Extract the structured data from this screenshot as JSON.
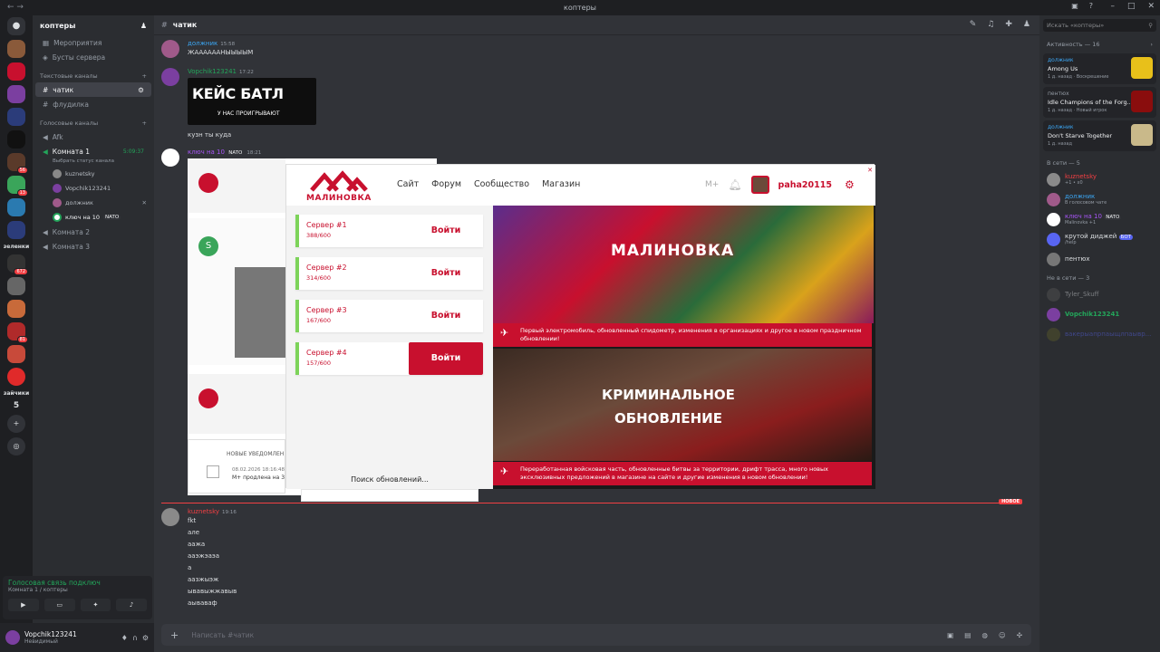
{
  "window": {
    "title": "коптеры"
  },
  "guilds": {
    "badges": [
      "56",
      "13",
      "672",
      "81"
    ],
    "count_label": "5",
    "side_labels": [
      "зеленки",
      "зайчики"
    ]
  },
  "server": {
    "name": "коптеры"
  },
  "sidebar": {
    "top": [
      {
        "label": "Мероприятия"
      },
      {
        "label": "Бусты сервера"
      }
    ],
    "text_category": "Текстовые каналы",
    "text_channels": [
      {
        "label": "чатик"
      },
      {
        "label": "флудилка"
      }
    ],
    "voice_category": "Голосовые каналы",
    "voice_channels": [
      {
        "label": "Afk"
      },
      {
        "label": "Комната 1",
        "timer": "5:09:37",
        "status": "Выбрать статус канала"
      },
      {
        "label": "Комната 2"
      },
      {
        "label": "Комната 3"
      }
    ],
    "voice_users": [
      {
        "name": "kuznetsky"
      },
      {
        "name": "Vopchik123241"
      },
      {
        "name": "должник"
      },
      {
        "name": "ключ на 10",
        "tag": "NATO"
      }
    ]
  },
  "voice_panel": {
    "status": "Голосовая связь подключ",
    "location": "Комната 1 / коптеры"
  },
  "user_panel": {
    "name": "Vopchik123241",
    "status": "Невидимый"
  },
  "chat": {
    "channel": "чатик",
    "input_placeholder": "Написать #чатик",
    "new_label": "НОВОЕ",
    "messages": [
      {
        "author": "должник",
        "time": "15:58",
        "text": "ЖААААААНЫЫЫЫМ"
      },
      {
        "author": "Vopchik123241",
        "time": "17:22",
        "text": "кузн ты куда",
        "image_title": "КЕЙС БАТЛ",
        "image_sub": "У НАС ПРОИГРЫВАЮТ"
      },
      {
        "author": "ключ на 10",
        "tag": "NATO",
        "time": "18:21"
      },
      {
        "author": "kuznetsky",
        "time": "19:16",
        "lines": [
          "fkt",
          "але",
          "аажа",
          "ааэжэаэа",
          "а",
          "аазжыэж",
          "ывавыжжавыв",
          "аываваф"
        ]
      }
    ]
  },
  "embed": {
    "notif_title": "НОВЫЕ УВЕДОМЛЕН",
    "notif_date": "08.02.2026 18:16:48",
    "notif_text": "М+ продлена на 3"
  },
  "launcher": {
    "logo": "МАЛИНОВКА",
    "nav": [
      "Сайт",
      "Форум",
      "Сообщество",
      "Магазин"
    ],
    "mplus": "М+",
    "username": "paha20115",
    "servers": [
      {
        "name": "Сервер #1",
        "count": "388/600",
        "btn": "Войти"
      },
      {
        "name": "Сервер #2",
        "count": "314/600",
        "btn": "Войти"
      },
      {
        "name": "Сервер #3",
        "count": "167/600",
        "btn": "Войти"
      },
      {
        "name": "Сервер #4",
        "count": "157/600",
        "btn": "Войти"
      }
    ],
    "update_status": "Поиск обновлений...",
    "news": [
      {
        "banner": "МАЛИНОВКА",
        "caption": "Первый электромобиль, обновленный спидометр, изменения в организациях и другое в новом праздничном обновлении!"
      },
      {
        "banner_line1": "КРИМИНАЛЬНОЕ",
        "banner_line2": "ОБНОВЛЕНИЕ",
        "caption": "Переработанная войсковая часть, обновленные битвы за территории, дрифт трасса, много новых эксклюзивных предложений в магазине на сайте и другие изменения в новом обновлении!"
      }
    ]
  },
  "members": {
    "search_placeholder": "Искать «коптеры»",
    "activity_header": "Активность — 16",
    "activities": [
      {
        "user": "должник",
        "game": "Among Us",
        "time": "1 д. назад",
        "status": "Воскрешение"
      },
      {
        "user": "пентюх",
        "game": "Idle Champions of the Forg...",
        "time": "1 д. назад",
        "status": "Новый игрок"
      },
      {
        "user": "должник",
        "game": "Don't Starve Together",
        "time": "1 д. назад",
        "status": ""
      }
    ],
    "online_header": "В сети — 5",
    "online": [
      {
        "name": "kuznetsky",
        "sub": "+1 • x0",
        "color": "#f23f43"
      },
      {
        "name": "должник",
        "sub": "В голосовом чате",
        "color": "#5865f2"
      },
      {
        "name": "ключ на 10",
        "tag": "NATO",
        "sub": "Malinovka +1",
        "color": "#a855f7"
      },
      {
        "name": "крутой диджей",
        "tag": "БОТ",
        "sub": "/help",
        "color": "#dbdee1"
      },
      {
        "name": "пентюх",
        "sub": "",
        "color": "#dbdee1"
      }
    ],
    "offline_header": "Не в сети — 3",
    "offline": [
      {
        "name": "Tyler_Skuff",
        "color": "#80848e"
      },
      {
        "name": "Vopchik123241",
        "color": "#23a55a"
      },
      {
        "name": "вакерыапрпаыщлпаывр...",
        "color": "#5865f2"
      }
    ]
  },
  "colors": {
    "accent": "#c8102e",
    "online": "#23a55a",
    "blurple": "#5865f2"
  }
}
